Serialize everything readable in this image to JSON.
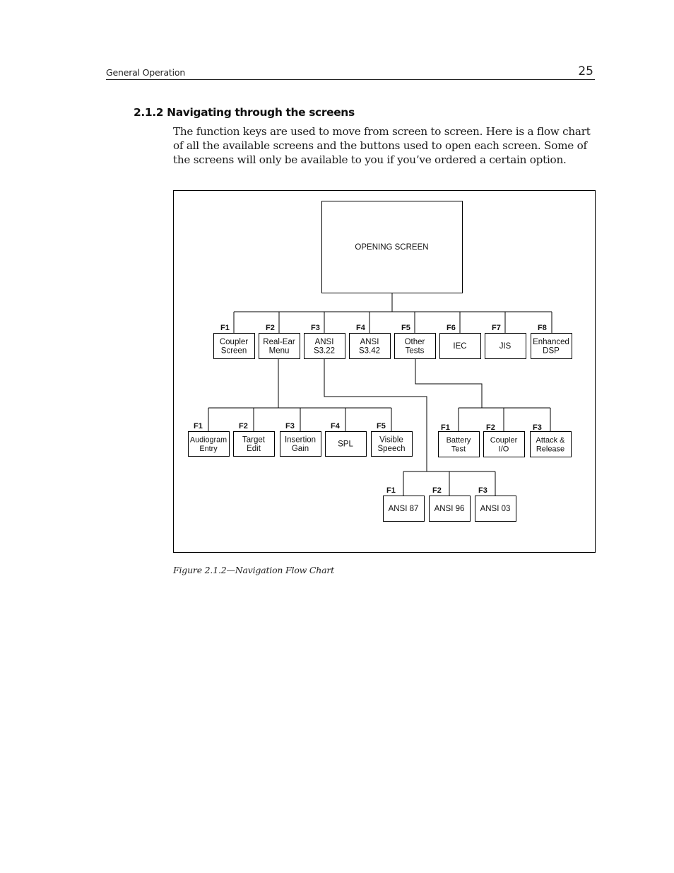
{
  "header": {
    "section_title": "General Operation",
    "page_number": "25"
  },
  "section": {
    "heading": "2.1.2 Navigating through the screens",
    "body_lines": [
      "The function keys are used to move from screen to screen. Here is a flow chart",
      "of all the available screens and the buttons used to open each screen. Some of",
      "the screens will only be available to you if you’ve ordered a certain option."
    ]
  },
  "figure": {
    "caption": "Figure 2.1.2—Navigation Flow Chart",
    "root": {
      "id": "opening",
      "label": [
        "OPENING SCREEN"
      ]
    },
    "level1": [
      {
        "id": "coupler-screen",
        "key": "F1",
        "label": [
          "Coupler",
          "Screen"
        ]
      },
      {
        "id": "real-ear-menu",
        "key": "F2",
        "label": [
          "Real-Ear",
          "Menu"
        ]
      },
      {
        "id": "ansi-s322",
        "key": "F3",
        "label": [
          "ANSI",
          "S3.22"
        ]
      },
      {
        "id": "ansi-s342",
        "key": "F4",
        "label": [
          "ANSI",
          "S3.42"
        ]
      },
      {
        "id": "other-tests",
        "key": "F5",
        "label": [
          "Other",
          "Tests"
        ]
      },
      {
        "id": "iec",
        "key": "F6",
        "label": [
          "IEC"
        ]
      },
      {
        "id": "jis",
        "key": "F7",
        "label": [
          "JIS"
        ]
      },
      {
        "id": "enhanced-dsp",
        "key": "F8",
        "label": [
          "Enhanced",
          "DSP"
        ]
      }
    ],
    "real_ear_children": [
      {
        "id": "audiogram-entry",
        "key": "F1",
        "label": [
          "Audiogram",
          "Entry"
        ]
      },
      {
        "id": "target-edit",
        "key": "F2",
        "label": [
          "Target",
          "Edit"
        ]
      },
      {
        "id": "insertion-gain",
        "key": "F3",
        "label": [
          "Insertion",
          "Gain"
        ]
      },
      {
        "id": "spl",
        "key": "F4",
        "label": [
          "SPL"
        ]
      },
      {
        "id": "visible-speech",
        "key": "F5",
        "label": [
          "Visible",
          "Speech"
        ]
      }
    ],
    "other_tests_children": [
      {
        "id": "battery-test",
        "key": "F1",
        "label": [
          "Battery",
          "Test"
        ]
      },
      {
        "id": "coupler-io",
        "key": "F2",
        "label": [
          "Coupler",
          "I/O"
        ]
      },
      {
        "id": "attack-release",
        "key": "F3",
        "label": [
          "Attack &",
          "Release"
        ]
      }
    ],
    "ansi_s322_children": [
      {
        "id": "ansi-87",
        "key": "F1",
        "label": [
          "ANSI 87"
        ]
      },
      {
        "id": "ansi-96",
        "key": "F2",
        "label": [
          "ANSI 96"
        ]
      },
      {
        "id": "ansi-03",
        "key": "F3",
        "label": [
          "ANSI 03"
        ]
      }
    ]
  }
}
